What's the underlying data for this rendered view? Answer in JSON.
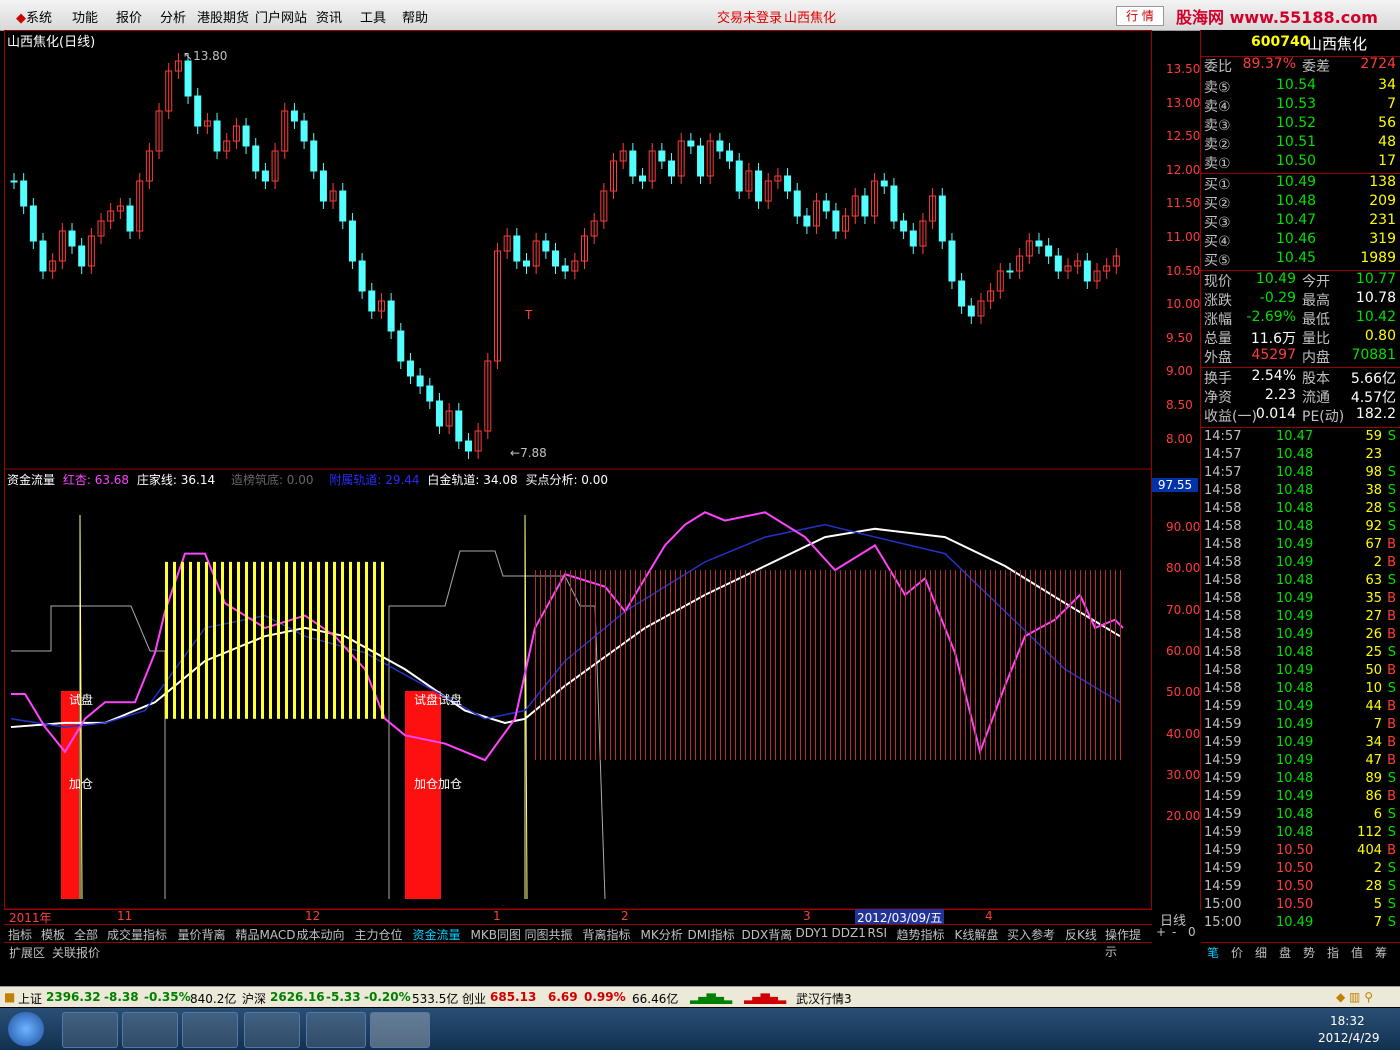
{
  "menu": {
    "items": [
      "系统",
      "功能",
      "报价",
      "分析",
      "港股期货",
      "门户网站",
      "资讯",
      "工具",
      "帮助"
    ],
    "status": "交易未登录",
    "stock_name": "山西焦化",
    "hq_button": "行 情",
    "watermark": "股海网 www.55188.com"
  },
  "kline": {
    "title": "山西焦化(日线)",
    "high_label": "13.80",
    "low_label": "7.88",
    "t_marker": "T",
    "y_ticks": [
      "13.50",
      "13.00",
      "12.50",
      "12.00",
      "11.50",
      "11.00",
      "10.50",
      "10.00",
      "9.50",
      "9.00",
      "8.50",
      "8.00"
    ]
  },
  "indicator": {
    "name": "资金流量",
    "hongxing": "红杏: 63.68",
    "zhuangjia": "庄家线: 36.14",
    "zaobang": "造榜筑底: 0.00",
    "fuyu": "附属轨道: 29.44",
    "baijin": "白金轨道: 34.08",
    "maidian": "买点分析: 0.00",
    "current_value": "97.55",
    "y_ticks": [
      "90.00",
      "80.00",
      "70.00",
      "60.00",
      "50.00",
      "40.00",
      "30.00",
      "20.00"
    ],
    "shipan": "试盘",
    "jiacang": "加仓"
  },
  "time_axis": {
    "labels": [
      "2011年",
      "11",
      "12",
      "1",
      "2",
      "3",
      "2012/03/09/五",
      "4"
    ],
    "right_label": "日线"
  },
  "quote": {
    "code": "600740",
    "name": "山西焦化",
    "weibi_label": "委比",
    "weibi": "89.37%",
    "weicha_label": "委差",
    "weicha": "2724",
    "asks": [
      {
        "label": "卖⑤",
        "price": "10.54",
        "vol": "34"
      },
      {
        "label": "卖④",
        "price": "10.53",
        "vol": "7"
      },
      {
        "label": "卖③",
        "price": "10.52",
        "vol": "56"
      },
      {
        "label": "卖②",
        "price": "10.51",
        "vol": "48"
      },
      {
        "label": "卖①",
        "price": "10.50",
        "vol": "17"
      }
    ],
    "bids": [
      {
        "label": "买①",
        "price": "10.49",
        "vol": "138"
      },
      {
        "label": "买②",
        "price": "10.48",
        "vol": "209"
      },
      {
        "label": "买③",
        "price": "10.47",
        "vol": "231"
      },
      {
        "label": "买④",
        "price": "10.46",
        "vol": "319"
      },
      {
        "label": "买⑤",
        "price": "10.45",
        "vol": "1989"
      }
    ],
    "stats": [
      {
        "l1": "现价",
        "v1": "10.49",
        "l2": "今开",
        "v2": "10.77"
      },
      {
        "l1": "涨跌",
        "v1": "-0.29",
        "l2": "最高",
        "v2": "10.78"
      },
      {
        "l1": "涨幅",
        "v1": "-2.69%",
        "l2": "最低",
        "v2": "10.42"
      },
      {
        "l1": "总量",
        "v1": "11.6万",
        "l2": "量比",
        "v2": "0.80"
      },
      {
        "l1": "外盘",
        "v1": "45297",
        "l2": "内盘",
        "v2": "70881"
      }
    ],
    "stats2": [
      {
        "l1": "换手",
        "v1": "2.54%",
        "l2": "股本",
        "v2": "5.66亿"
      },
      {
        "l1": "净资",
        "v1": "2.23",
        "l2": "流通",
        "v2": "4.57亿"
      },
      {
        "l1": "收益(一)",
        "v1": "0.014",
        "l2": "PE(动)",
        "v2": "182.2"
      }
    ],
    "ticks": [
      {
        "t": "14:57",
        "p": "10.47",
        "v": "59",
        "s": "S"
      },
      {
        "t": "14:57",
        "p": "10.48",
        "v": "23",
        "s": ""
      },
      {
        "t": "14:57",
        "p": "10.48",
        "v": "98",
        "s": "S"
      },
      {
        "t": "14:58",
        "p": "10.48",
        "v": "38",
        "s": "S"
      },
      {
        "t": "14:58",
        "p": "10.48",
        "v": "28",
        "s": "S"
      },
      {
        "t": "14:58",
        "p": "10.48",
        "v": "92",
        "s": "S"
      },
      {
        "t": "14:58",
        "p": "10.49",
        "v": "67",
        "s": "B"
      },
      {
        "t": "14:58",
        "p": "10.49",
        "v": "2",
        "s": "B"
      },
      {
        "t": "14:58",
        "p": "10.48",
        "v": "63",
        "s": "S"
      },
      {
        "t": "14:58",
        "p": "10.49",
        "v": "35",
        "s": "B"
      },
      {
        "t": "14:58",
        "p": "10.49",
        "v": "27",
        "s": "B"
      },
      {
        "t": "14:58",
        "p": "10.49",
        "v": "26",
        "s": "B"
      },
      {
        "t": "14:58",
        "p": "10.48",
        "v": "25",
        "s": "S"
      },
      {
        "t": "14:58",
        "p": "10.49",
        "v": "50",
        "s": "B"
      },
      {
        "t": "14:58",
        "p": "10.48",
        "v": "10",
        "s": "S"
      },
      {
        "t": "14:59",
        "p": "10.49",
        "v": "44",
        "s": "B"
      },
      {
        "t": "14:59",
        "p": "10.49",
        "v": "7",
        "s": "B"
      },
      {
        "t": "14:59",
        "p": "10.49",
        "v": "34",
        "s": "B"
      },
      {
        "t": "14:59",
        "p": "10.49",
        "v": "47",
        "s": "B"
      },
      {
        "t": "14:59",
        "p": "10.48",
        "v": "89",
        "s": "S"
      },
      {
        "t": "14:59",
        "p": "10.49",
        "v": "86",
        "s": "B"
      },
      {
        "t": "14:59",
        "p": "10.48",
        "v": "6",
        "s": "S"
      },
      {
        "t": "14:59",
        "p": "10.48",
        "v": "112",
        "s": "S"
      },
      {
        "t": "14:59",
        "p": "10.50",
        "v": "404",
        "s": "B"
      },
      {
        "t": "14:59",
        "p": "10.50",
        "v": "2",
        "s": "S"
      },
      {
        "t": "14:59",
        "p": "10.50",
        "v": "28",
        "s": "S"
      },
      {
        "t": "15:00",
        "p": "10.50",
        "v": "5",
        "s": "S"
      },
      {
        "t": "15:00",
        "p": "10.49",
        "v": "7",
        "s": "S"
      }
    ],
    "bottom_tabs": [
      "笔",
      "价",
      "细",
      "盘",
      "势",
      "指",
      "值",
      "筹"
    ]
  },
  "indicator_tabs": [
    "指标",
    "模板",
    "全部",
    "成交量指标",
    "量价背离",
    "精品MACD",
    "成本动向",
    "主力仓位",
    "资金流量",
    "MKB同图",
    "同图共振",
    "背离指标",
    "MK分析",
    "DMI指标",
    "DDX背离",
    "DDY1",
    "DDZ1",
    "RSI",
    "趋势指标",
    "K线解盘",
    "买入参考",
    "反K线",
    "操作提示"
  ],
  "active_tab": "资金流量",
  "sub_tabs": [
    "扩展区",
    "关联报价"
  ],
  "tab_controls": [
    "+",
    "-",
    "0"
  ],
  "status_bar": {
    "sh_label": "上证",
    "sh_val": "2396.32",
    "sh_chg": "-8.38",
    "sh_pct": "-0.35%",
    "sh_amt": "840.2亿",
    "sz_label": "沪深",
    "sz_val": "2626.16",
    "sz_chg": "-5.33",
    "sz_pct": "-0.20%",
    "sz_amt": "533.5亿",
    "cy_label": "创业",
    "cy_val": "685.13",
    "cy_chg": "6.69",
    "cy_pct": "0.99%",
    "cy_amt": "66.46亿",
    "news": "武汉行情3"
  },
  "taskbar": {
    "time": "18:32",
    "date": "2012/4/29"
  },
  "colors": {
    "up": "#ff3c3c",
    "down": "#54ffff",
    "grid": "#990000"
  }
}
